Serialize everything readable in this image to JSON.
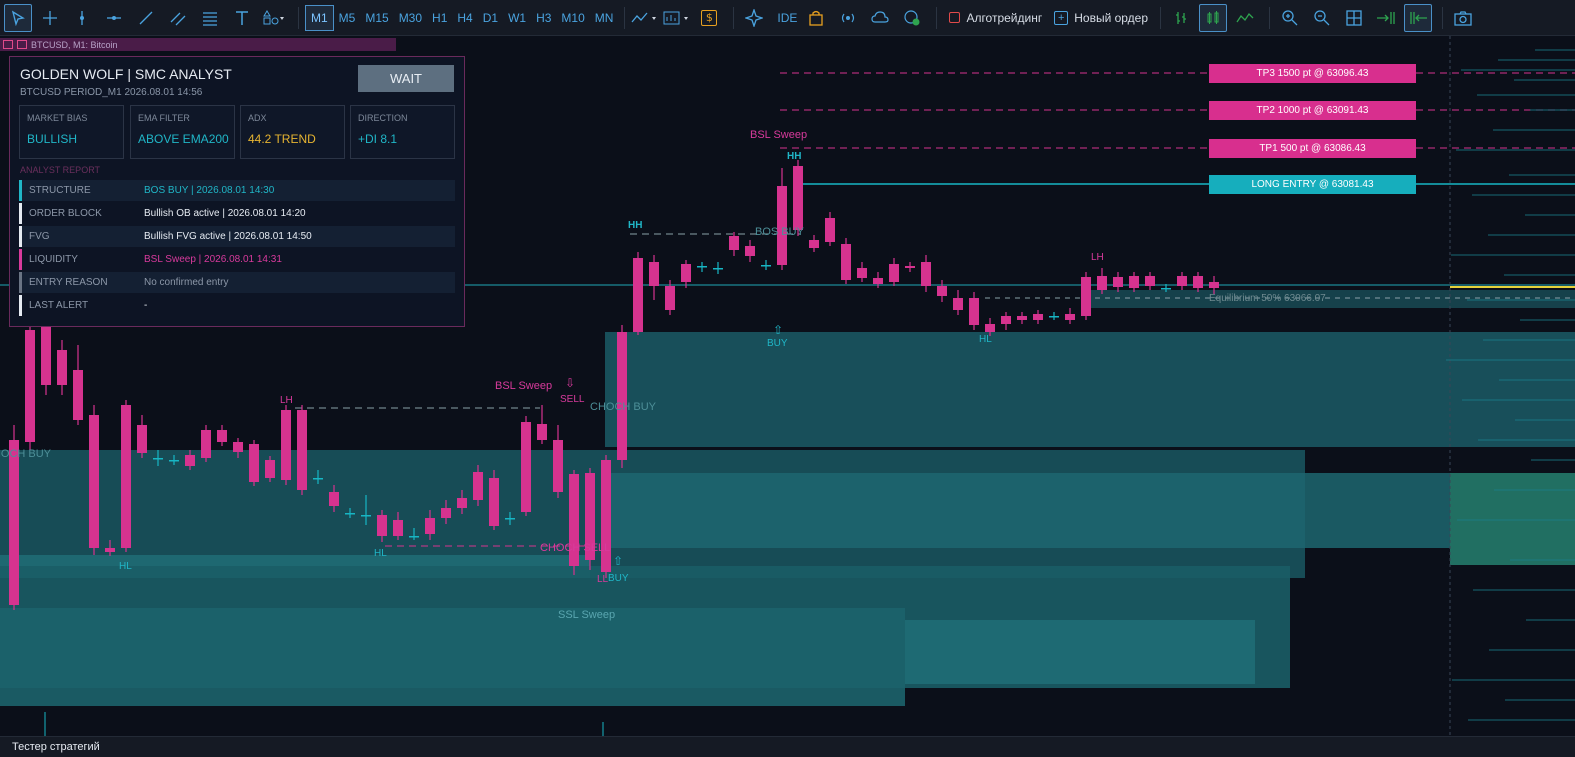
{
  "toolbar": {
    "timeframes": [
      "M1",
      "M5",
      "M15",
      "M30",
      "H1",
      "H4",
      "D1",
      "W1",
      "H3",
      "M10",
      "MN"
    ],
    "active_timeframe": "M1",
    "ide_label": "IDE",
    "algotrading_label": "Алготрейдинг",
    "new_order_label": "Новый ордер"
  },
  "symbol_bar": {
    "text": "BTCUSD, M1:  Bitcoin"
  },
  "panel": {
    "title": "GOLDEN WOLF  |  SMC ANALYST",
    "subtitle": "BTCUSD  PERIOD_M1  2026.08.01 14:56",
    "signal_button": "WAIT",
    "cards": [
      {
        "label": "MARKET BIAS",
        "value": "BULLISH",
        "color": "#20b6c7"
      },
      {
        "label": "EMA FILTER",
        "value": "ABOVE EMA200",
        "color": "#20b6c7"
      },
      {
        "label": "ADX",
        "value": "44.2 TREND",
        "color": "#e6b431"
      },
      {
        "label": "DIRECTION",
        "value": "+DI 8.1",
        "color": "#20b6c7"
      }
    ],
    "report_title": "ANALYST REPORT",
    "report_rows": [
      {
        "label": "STRUCTURE",
        "value": "BOS BUY | 2026.08.01 14:30",
        "color": "#20b6c7",
        "bar": "#20b6c7"
      },
      {
        "label": "ORDER BLOCK",
        "value": "Bullish OB active | 2026.08.01 14:20",
        "color": "#e6ebf2",
        "bar": "#e6ebf2"
      },
      {
        "label": "FVG",
        "value": "Bullish FVG active | 2026.08.01 14:50",
        "color": "#e6ebf2",
        "bar": "#e6ebf2"
      },
      {
        "label": "LIQUIDITY",
        "value": "BSL Sweep | 2026.08.01 14:31",
        "color": "#d83a9c",
        "bar": "#d83a9c"
      },
      {
        "label": "ENTRY REASON",
        "value": "No confirmed entry",
        "color": "#8c97a8",
        "bar": "#6a7484"
      },
      {
        "label": "LAST ALERT",
        "value": "-",
        "color": "#e6ebf2",
        "bar": "#e6ebf2"
      }
    ]
  },
  "levels": {
    "tp3": "TP3  1500 pt  @ 63096.43",
    "tp2": "TP2  1000 pt  @ 63091.43",
    "tp1": "TP1  500 pt  @ 63086.43",
    "entry": "LONG ENTRY  @ 63081.43",
    "equilibrium": "Equilibrium 50%  63066.07"
  },
  "annotations": {
    "bsl_sweep_top": "BSL Sweep",
    "hh_top": "HH",
    "bos_buy": "BOS BUY",
    "hh_left": "HH",
    "buy_mid": "BUY",
    "lh_right": "LH",
    "hl_right": "HL",
    "bsl_sweep_mid": "BSL Sweep",
    "sell": "SELL",
    "lh_left": "LH",
    "choch_buy_mid": "CHOCH BUY",
    "choch_buy_left": "CHOCH BUY",
    "hl_left": "HL",
    "hl_mid": "HL",
    "choch_sell": "CHOCH SELL",
    "ll": "LL",
    "buy_low": "BUY",
    "ssl_sweep": "SSL Sweep"
  },
  "colors": {
    "bull": "#17b6c4",
    "bear": "#d6338f",
    "zone": "#1b5a63",
    "tp": "#d82f8e",
    "entry": "#16aebd"
  },
  "bottom_bar": {
    "label": "Тестер стратегий"
  }
}
